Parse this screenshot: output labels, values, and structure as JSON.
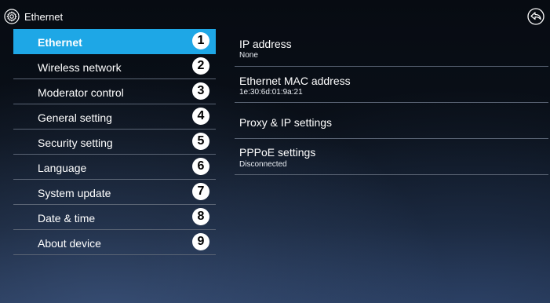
{
  "header": {
    "title": "Ethernet"
  },
  "sidebar": {
    "items": [
      {
        "label": "Ethernet",
        "number": "1"
      },
      {
        "label": "Wireless network",
        "number": "2"
      },
      {
        "label": "Moderator control",
        "number": "3"
      },
      {
        "label": "General setting",
        "number": "4"
      },
      {
        "label": "Security setting",
        "number": "5"
      },
      {
        "label": "Language",
        "number": "6"
      },
      {
        "label": "System update",
        "number": "7"
      },
      {
        "label": "Date & time",
        "number": "8"
      },
      {
        "label": "About device",
        "number": "9"
      }
    ],
    "active_index": 0
  },
  "settings": {
    "ip": {
      "label": "IP address",
      "value": "None"
    },
    "mac": {
      "label": "Ethernet MAC address",
      "value": "1e:30:6d:01:9a:21"
    },
    "proxy": {
      "label": "Proxy & IP settings"
    },
    "pppoe": {
      "label": "PPPoE settings",
      "value": "Disconnected"
    }
  },
  "icons": {
    "header": "settings-gear-icon",
    "back": "back-arrow-icon"
  },
  "colors": {
    "accent": "#1ea7e6",
    "divider": "#5a6474",
    "background": "#070b12"
  }
}
